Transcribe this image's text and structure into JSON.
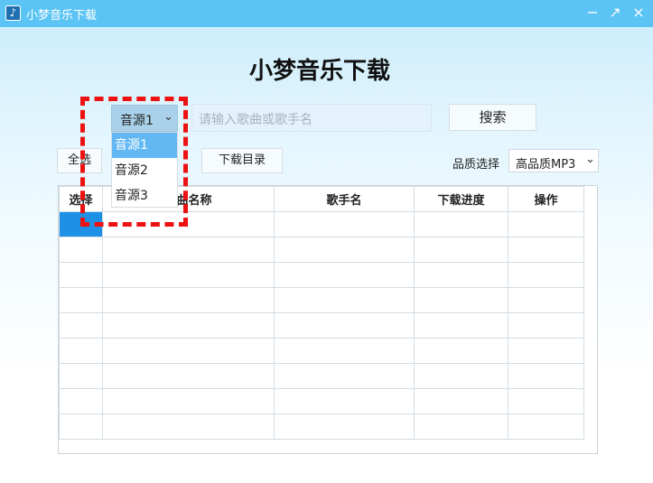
{
  "window": {
    "title": "小梦音乐下载",
    "icon": "music-note-icon",
    "controls": {
      "minimize": "−",
      "maximize": "↗",
      "close": "×"
    }
  },
  "heading": "小梦音乐下载",
  "search": {
    "source_selected": "音源1",
    "source_options": [
      "音源1",
      "音源2",
      "音源3"
    ],
    "placeholder": "请输入歌曲或歌手名",
    "button_label": "搜索"
  },
  "toolbar": {
    "select_all_label": "全选",
    "download_dir_label": "下载目录",
    "quality_label": "品质选择",
    "quality_selected": "高品质MP3"
  },
  "table": {
    "headers": [
      "选择",
      "歌曲名称",
      "歌手名",
      "下载进度",
      "操作"
    ],
    "row_count": 9,
    "selected_row": 0
  },
  "colors": {
    "titlebar": "#5cc4f4",
    "accent": "#1e90e6",
    "dropdown_active": "#63b8f3",
    "highlight": "#ee1111"
  }
}
